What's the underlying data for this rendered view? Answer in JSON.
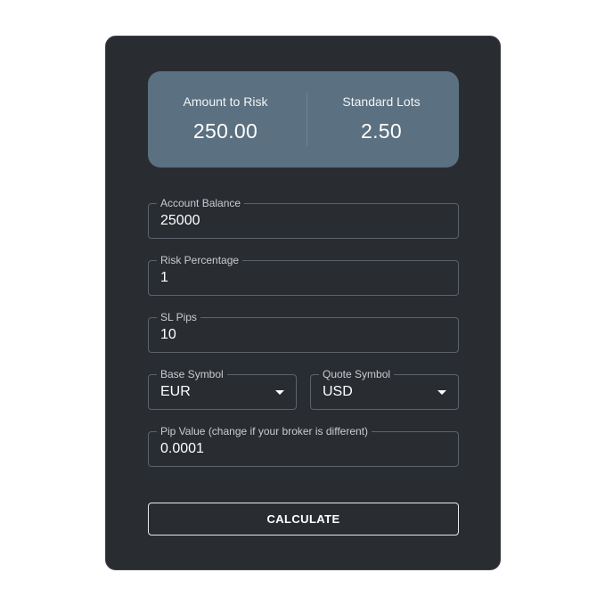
{
  "summary": {
    "amount_label": "Amount to Risk",
    "amount_value": "250.00",
    "lots_label": "Standard Lots",
    "lots_value": "2.50"
  },
  "form": {
    "account_balance": {
      "label": "Account Balance",
      "value": "25000"
    },
    "risk_percentage": {
      "label": "Risk Percentage",
      "value": "1"
    },
    "sl_pips": {
      "label": "SL Pips",
      "value": "10"
    },
    "base_symbol": {
      "label": "Base Symbol",
      "value": "EUR"
    },
    "quote_symbol": {
      "label": "Quote Symbol",
      "value": "USD"
    },
    "pip_value": {
      "label": "Pip Value (change if your broker is different)",
      "value": "0.0001"
    }
  },
  "actions": {
    "calculate_label": "CALCULATE"
  },
  "colors": {
    "card_bg": "#292d32",
    "summary_bg": "#5b7080",
    "page_bg": "#ffffff"
  }
}
